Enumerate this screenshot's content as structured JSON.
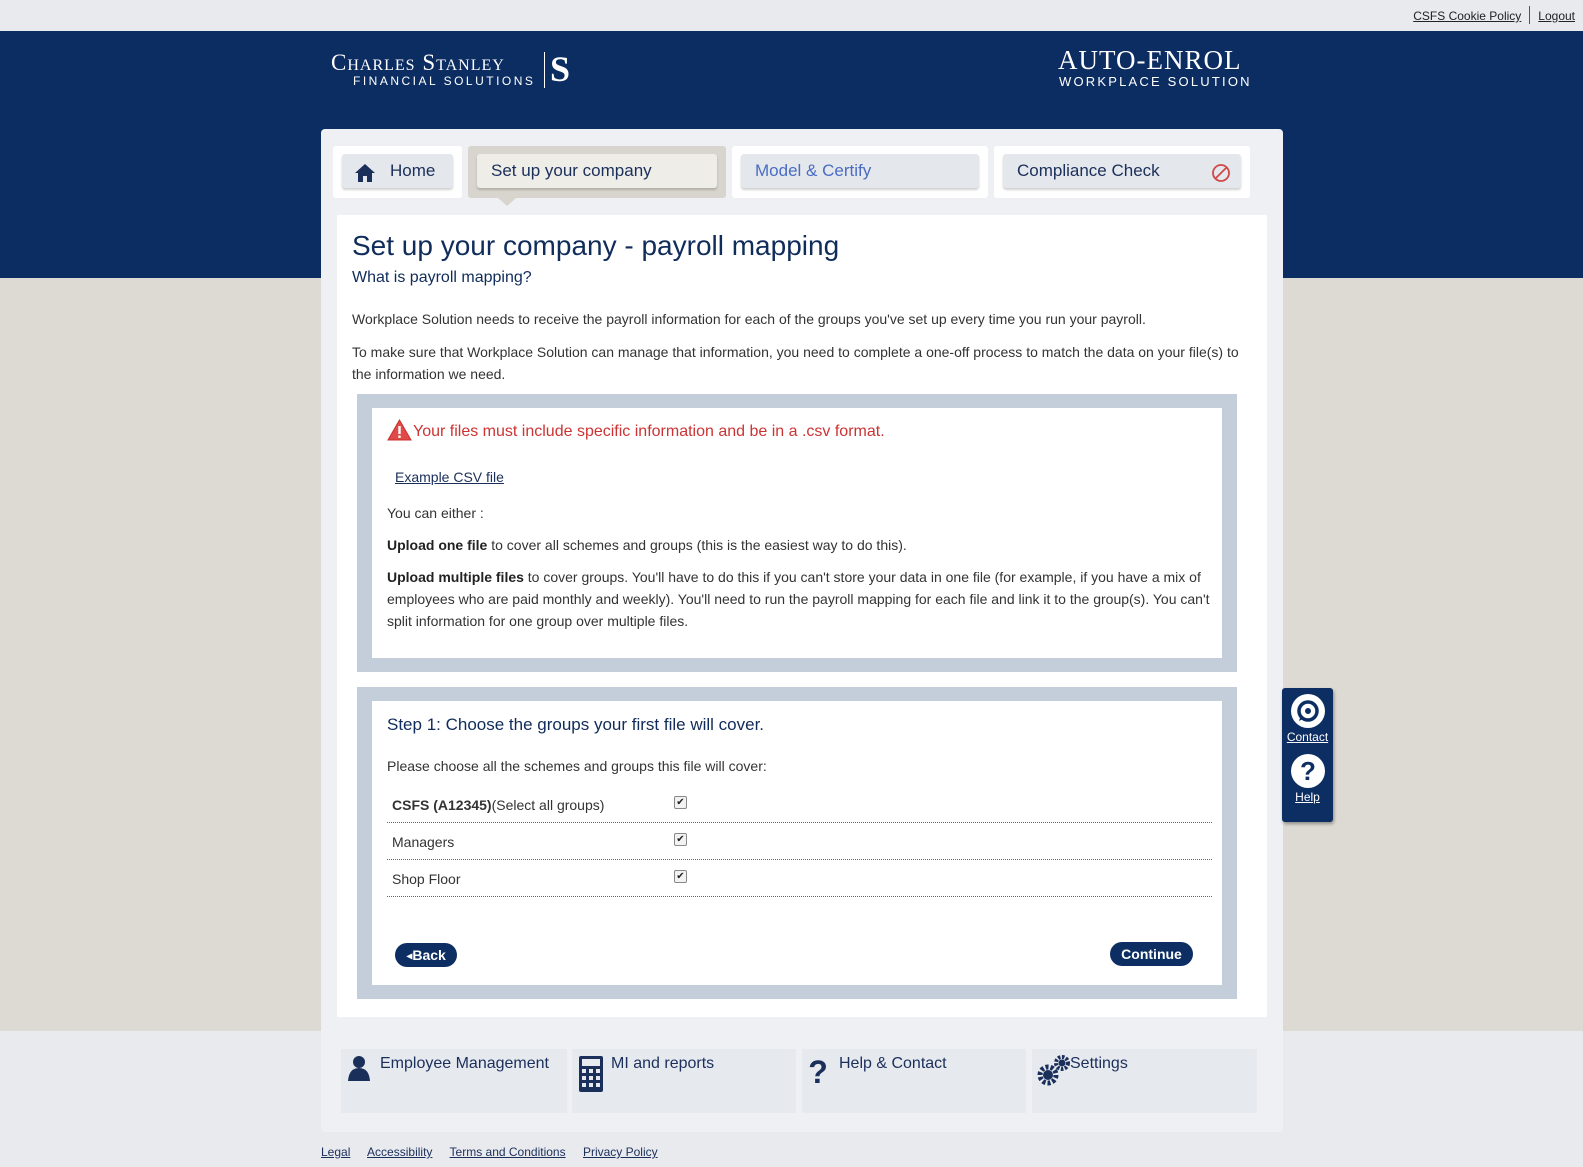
{
  "topbar": {
    "cookie_policy": "CSFS Cookie Policy",
    "logout": "Logout"
  },
  "brand": {
    "left_line1": "Charles Stanley",
    "left_line2": "Financial Solutions",
    "left_mark": "S",
    "right_line1": "AUTO-ENROL",
    "right_line2": "Workplace Solution"
  },
  "tabs": [
    {
      "label": "Home"
    },
    {
      "label": "Set up your company"
    },
    {
      "label": "Model & Certify"
    },
    {
      "label": "Compliance Check"
    }
  ],
  "page": {
    "title": "Set up your company - payroll mapping",
    "subtitle": "What is payroll mapping?",
    "para1": "Workplace Solution needs to receive the payroll information for each of the groups you've set up every time you run your payroll.",
    "para2": "To make sure that Workplace Solution can manage that information, you need to complete a one-off process to match the data on your file(s) to the information we need."
  },
  "info_box": {
    "warning": "Your files must include specific information and be in a .csv format.",
    "example_link": "Example CSV file",
    "either": "You can either :",
    "one_file_bold": "Upload one file",
    "one_file_rest": " to cover all schemes and groups (this is the easiest way to do this).",
    "multi_bold": "Upload multiple files",
    "multi_rest": " to cover groups. You'll have to do this if you can't store your data in one file (for example, if you have a mix of employees who are paid monthly and weekly). You'll need to run the payroll mapping for each file and link it to the group(s). You can't split information for one group over multiple files."
  },
  "step1": {
    "title": "Step 1: Choose the groups your first file will cover.",
    "instruction": "Please choose all the schemes and groups this file will cover:",
    "scheme_bold": "CSFS (A12345)",
    "scheme_rest": "(Select all groups)",
    "groups": [
      {
        "label": "Managers"
      },
      {
        "label": "Shop Floor"
      }
    ],
    "back_label": "Back",
    "continue_label": "Continue"
  },
  "side": {
    "contact": "Contact",
    "help": "Help"
  },
  "bottom_nav": [
    {
      "label": "Employee Management"
    },
    {
      "label": "MI and reports"
    },
    {
      "label": "Help & Contact"
    },
    {
      "label": "Settings"
    }
  ],
  "footer": {
    "legal": "Legal",
    "accessibility": "Accessibility",
    "terms": "Terms and Conditions",
    "privacy": "Privacy Policy"
  },
  "colors": {
    "navy": "#0c2d62",
    "warning_red": "#cc3333",
    "panel_gray": "#dcdad2",
    "box_blue": "#c4cedb"
  }
}
